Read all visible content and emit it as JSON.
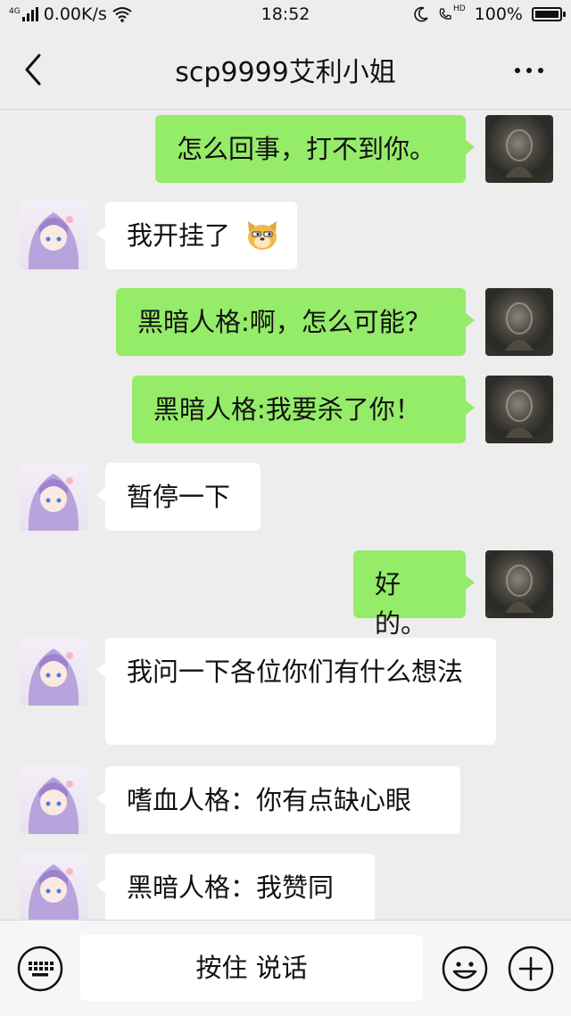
{
  "status_bar": {
    "network_type": "4G",
    "speed": "0.00K/s",
    "time": "18:52",
    "hd_label": "HD",
    "battery": "100%",
    "battery_level": 1.0
  },
  "header": {
    "title": "scp9999艾利小姐",
    "back_icon": "chevron-left-icon",
    "more_icon": "more-dots-icon"
  },
  "messages": [
    {
      "side": "right",
      "text": "怎么回事，打不到你。"
    },
    {
      "side": "left",
      "text": "我开挂了",
      "emoji": "doge-emoji"
    },
    {
      "side": "right",
      "text": "黑暗人格:啊，怎么可能？"
    },
    {
      "side": "right",
      "text": "黑暗人格:我要杀了你！"
    },
    {
      "side": "left",
      "text": "暂停一下"
    },
    {
      "side": "right",
      "text": "好的。"
    },
    {
      "side": "left",
      "text": "我问一下各位你们有什么想法"
    },
    {
      "side": "left",
      "text": "嗜血人格：你有点缺心眼"
    },
    {
      "side": "left",
      "text": "黑暗人格：我赞同"
    }
  ],
  "input_bar": {
    "voice_label": "按住 说话",
    "keyboard_icon": "keyboard-icon",
    "emoji_icon": "emoji-icon",
    "plus_icon": "plus-icon"
  },
  "colors": {
    "background": "#ededed",
    "self_bubble": "#95ec69",
    "other_bubble": "#ffffff"
  }
}
